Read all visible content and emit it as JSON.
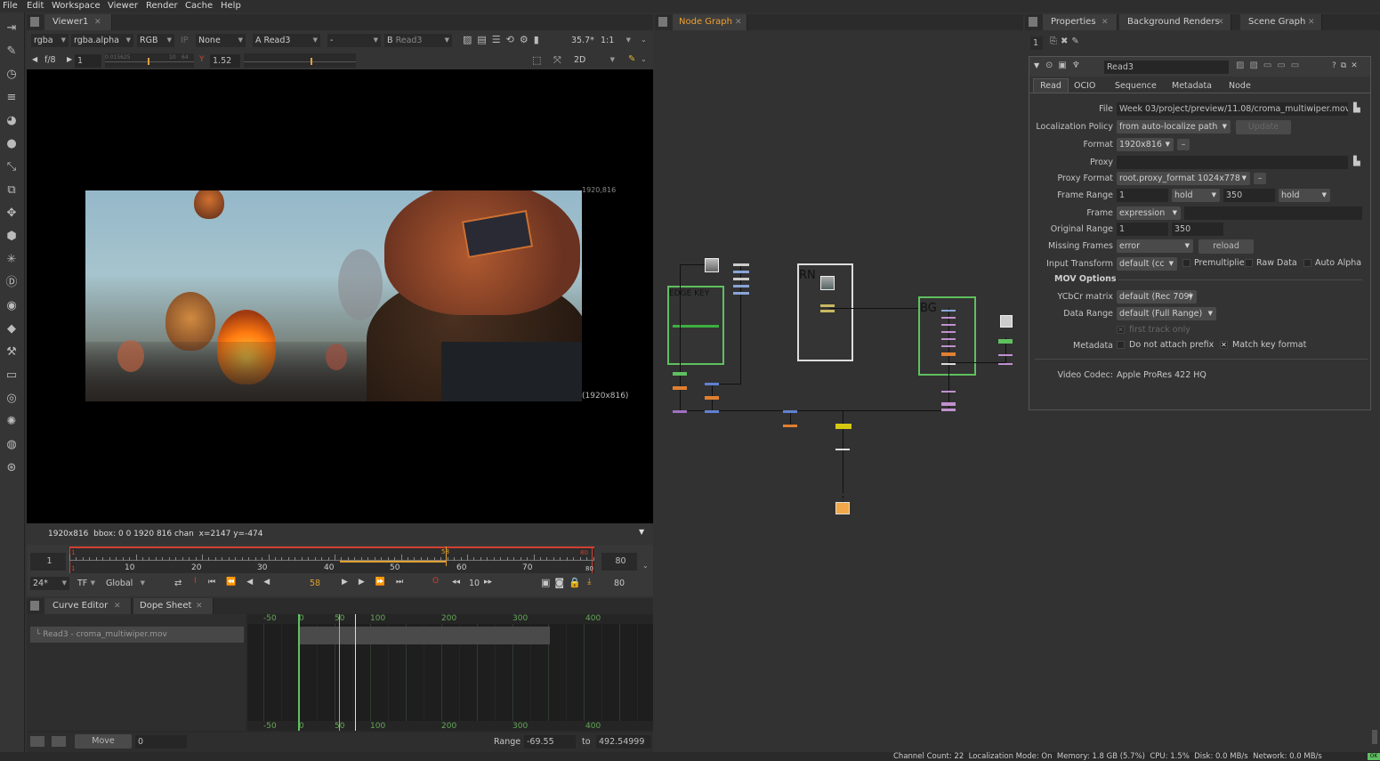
{
  "menu": [
    "File",
    "Edit",
    "Workspace",
    "Viewer",
    "Render",
    "Cache",
    "Help"
  ],
  "viewer": {
    "tab": "Viewer1",
    "channels": "rgba",
    "alpha": "rgba.alpha",
    "display": "RGB",
    "ip": "IP",
    "lut": "None",
    "input_a_label": "A",
    "input_a": "Read3",
    "wipe": "-",
    "input_b_label": "B",
    "input_b": "Read3",
    "zoom": "35.7*",
    "ratio": "1:1",
    "fstop": "f/8",
    "frame_field": "1",
    "gain_low": "0.015625",
    "gain_high": "10",
    "gain_high2": "64",
    "gamma_label": "Y",
    "gamma": "1.52",
    "view_mode": "2D",
    "format_tr": "1920,816",
    "format_br": "(1920x816)",
    "info": "1920x816  bbox: 0 0 1920 816 chan  x=2147 y=-474"
  },
  "timeline": {
    "start": "1",
    "end": "80",
    "end2": "80",
    "marks": [
      "10",
      "20",
      "30",
      "40",
      "50",
      "60",
      "70"
    ],
    "current": "58",
    "in_mark": "1",
    "out_mark": "80",
    "out_mark2": "80",
    "fps": "24*",
    "tf": "TF",
    "scope": "Global",
    "frame": "58",
    "step": "10"
  },
  "curve_panel": {
    "tabs": [
      "Curve Editor",
      "Dope Sheet"
    ],
    "track": "Read3 - croma_multiwiper.mov",
    "marks": [
      "-50",
      "0",
      "50",
      "100",
      "200",
      "300",
      "400"
    ],
    "move_label": "Move",
    "move_value": "0",
    "range_label": "Range",
    "range_from": "-69.55",
    "to_label": "to",
    "range_to": "492.54999"
  },
  "node_graph": {
    "tab": "Node Graph",
    "backdrops": [
      "EDGE KEY",
      "RN",
      "BG"
    ]
  },
  "props_tabs": [
    "Properties",
    "Background Renders",
    "Scene Graph"
  ],
  "properties": {
    "count": "1",
    "node_name": "Read3",
    "tabs": [
      "Read",
      "OCIO",
      "Sequence",
      "Metadata",
      "Node"
    ],
    "file_label": "File",
    "file": "Week 03/project/preview/11.08/croma_multiwiper.mov",
    "loc_label": "Localization Policy",
    "loc": "from auto-localize path",
    "update": "Update",
    "format_label": "Format",
    "format": "1920x816",
    "proxy_label": "Proxy",
    "proxy_format_label": "Proxy Format",
    "proxy_format": "root.proxy_format 1024x778",
    "frame_range_label": "Frame Range",
    "fr_start": "1",
    "fr_before": "hold",
    "fr_end": "350",
    "fr_after": "hold",
    "frame_label": "Frame",
    "frame_mode": "expression",
    "orig_label": "Original Range",
    "orig_start": "1",
    "orig_end": "350",
    "missing_label": "Missing Frames",
    "missing": "error",
    "reload": "reload",
    "input_tf_label": "Input Transform",
    "input_tf": "default (cc",
    "premult": "Premultiplie",
    "raw": "Raw Data",
    "auto_alpha": "Auto Alpha",
    "mov_options": "MOV Options",
    "ycbcr_label": "YCbCr matrix",
    "ycbcr": "default (Rec 709)",
    "range_label": "Data Range",
    "data_range": "default (Full Range)",
    "first_track": "first track only",
    "metadata_label": "Metadata",
    "no_prefix": "Do not attach prefix",
    "match_key": "Match key format",
    "codec_label": "Video Codec:",
    "codec": "Apple ProRes 422 HQ"
  },
  "status": "Channel Count: 22  Localization Mode: On  Memory: 1.8 GB (5.7%)  CPU: 1.5%  Disk: 0.0 MB/s  Network: 0.0 MB/s",
  "status_ok": "OK",
  "colors": {
    "accent": "#f0a030",
    "green": "#5fc060",
    "red": "#d04030"
  }
}
